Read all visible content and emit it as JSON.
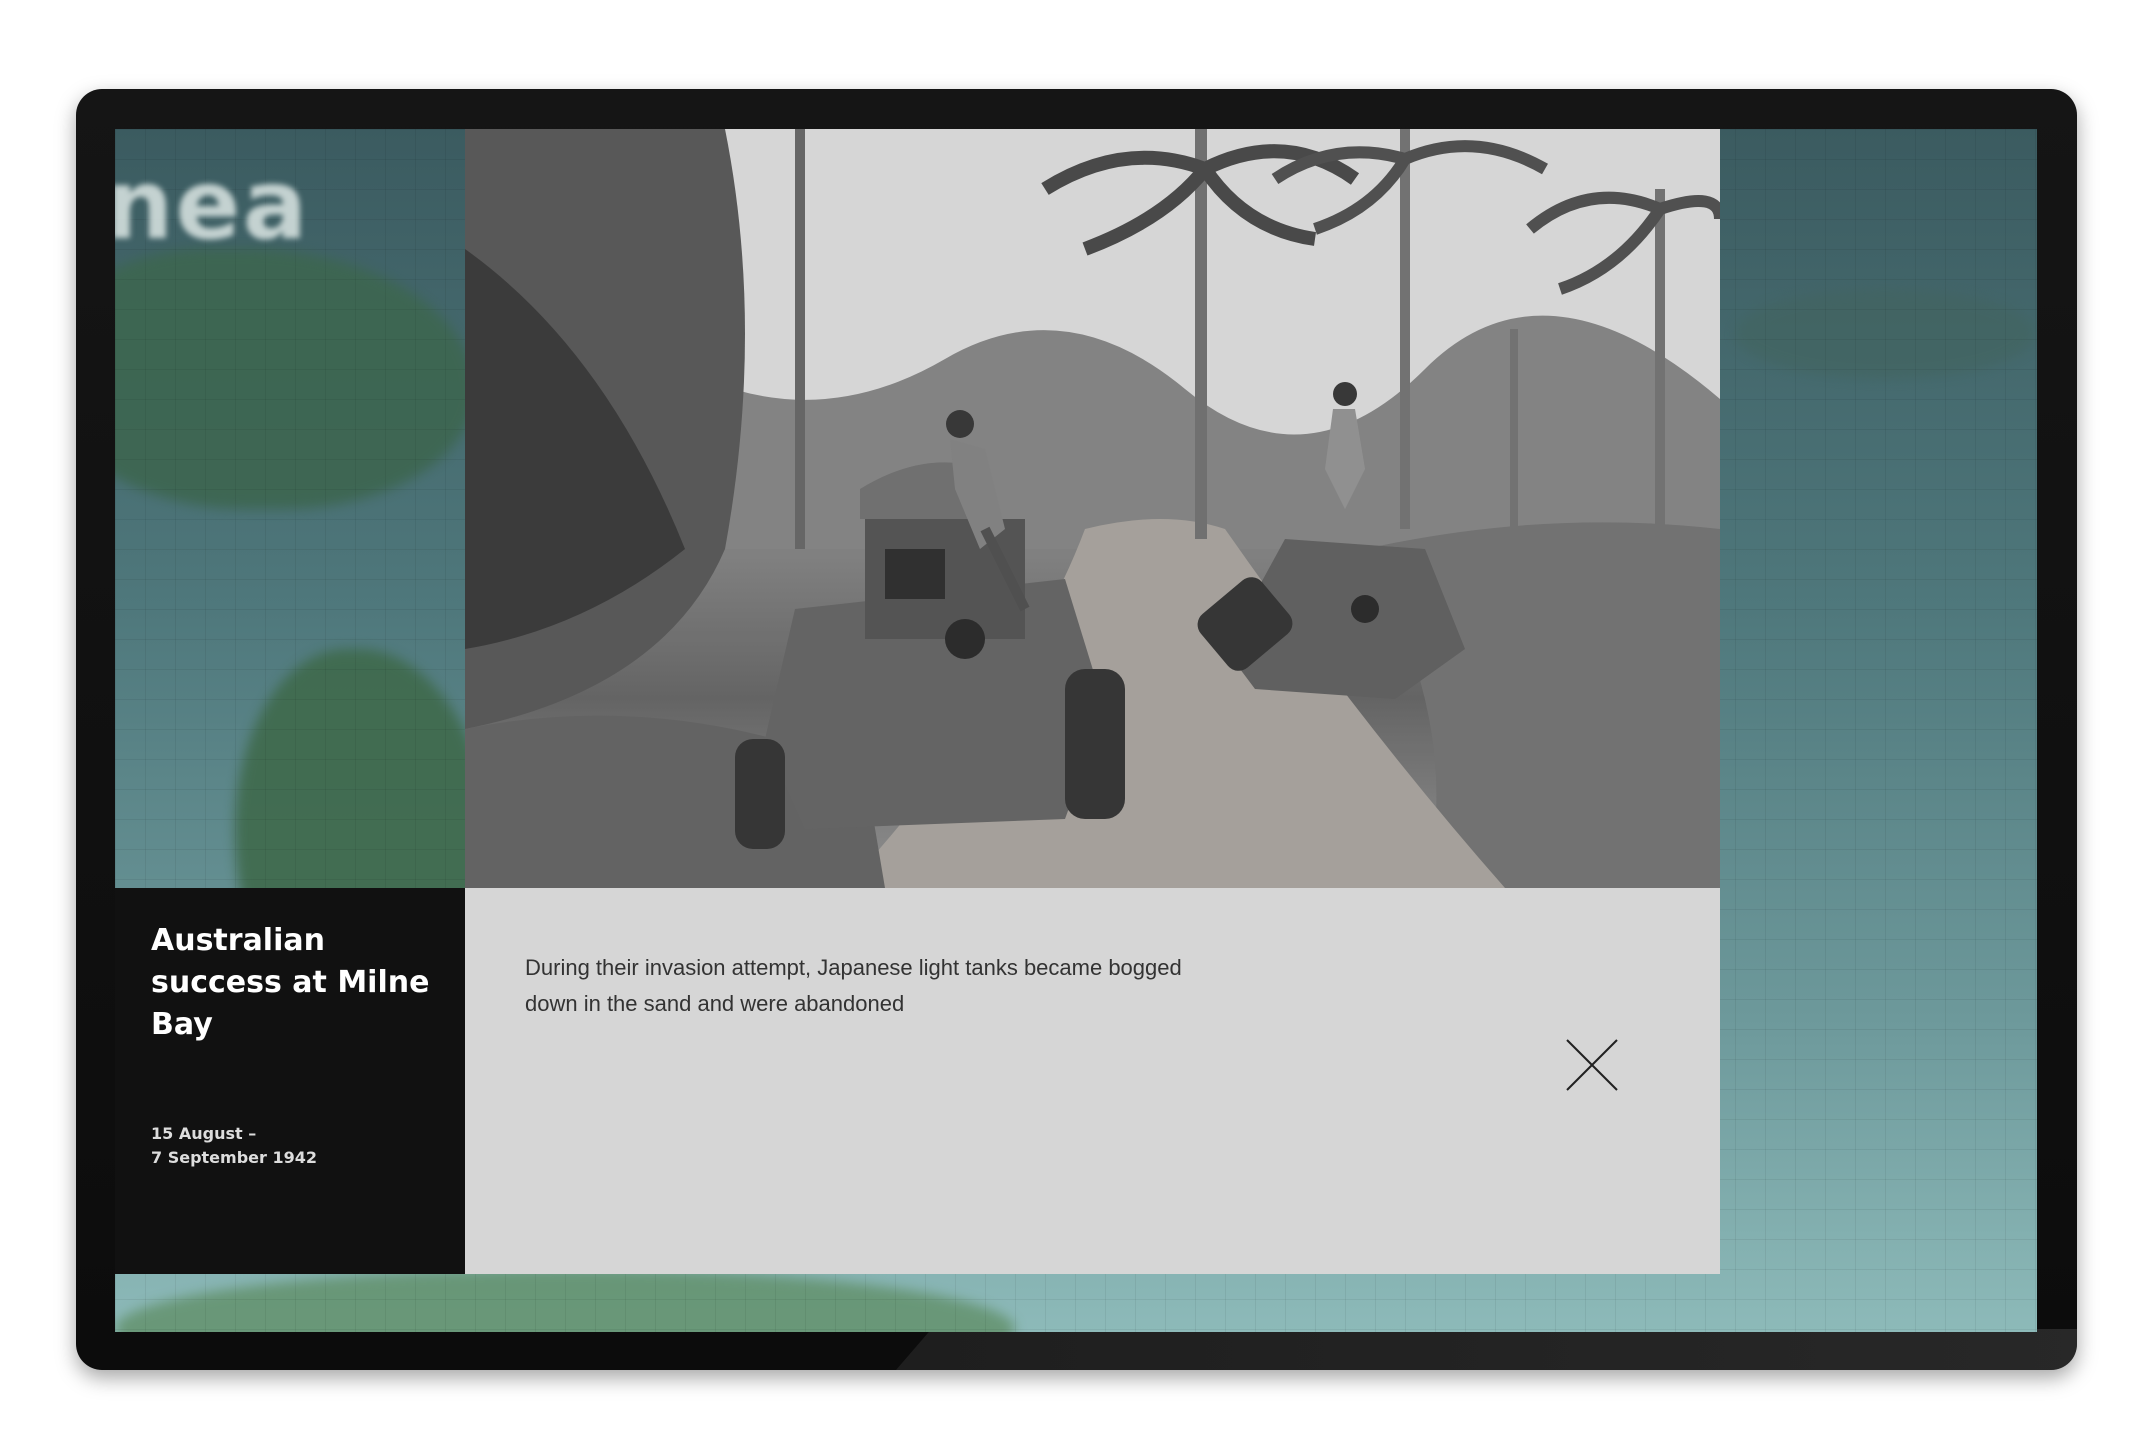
{
  "map": {
    "label": "nea"
  },
  "story": {
    "title": "Australian success at Milne Bay",
    "date_range": "15 August –\n7 September 1942"
  },
  "image": {
    "caption": "During their invasion attempt, Japanese light tanks became bogged down in the sand and were abandoned"
  },
  "controls": {
    "close_icon": "close-icon"
  }
}
